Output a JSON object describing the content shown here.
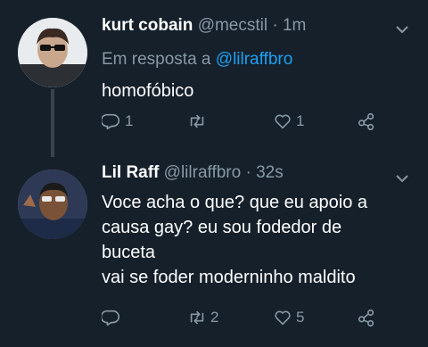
{
  "tweets": [
    {
      "name": "kurt cobain",
      "handle": "@mecstil",
      "separator": "·",
      "time": "1m",
      "reply_prefix": "Em resposta a",
      "reply_mention": "@lilraffbro",
      "lines": [
        "homofóbico"
      ],
      "counts": {
        "reply": "1",
        "retweet": "",
        "like": "1"
      }
    },
    {
      "name": "Lil Raff",
      "handle": "@lilraffbro",
      "separator": "·",
      "time": "32s",
      "lines": [
        "Voce acha o que? que eu apoio a",
        "causa gay? eu sou fodedor de",
        "buceta",
        "vai se foder moderninho maldito"
      ],
      "counts": {
        "reply": "",
        "retweet": "2",
        "like": "5"
      }
    }
  ],
  "icons": {
    "reply": "comment-bubble-icon",
    "retweet": "retweet-icon",
    "like": "heart-icon",
    "share": "share-icon",
    "more": "chevron-down-icon"
  },
  "colors": {
    "background": "#15202b",
    "text": "#ffffff",
    "muted": "#8899a6",
    "link": "#1da1f2"
  }
}
